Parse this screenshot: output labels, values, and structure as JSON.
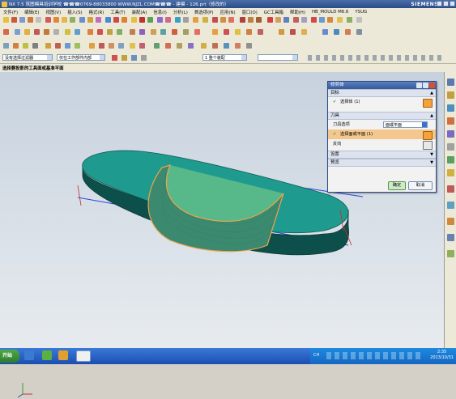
{
  "window": {
    "title": "NX 7.5 筑图模具培训学校  ☎☎☎0769-88033800  WWW.NJZL.COM☎☎☎ - 建模 - 126.prt（修改的）",
    "brand": "SIEMENS"
  },
  "menu": [
    "文件(F)",
    "编辑(E)",
    "视图(V)",
    "插入(S)",
    "格式(R)",
    "工具(T)",
    "装配(A)",
    "信息(I)",
    "分析(L)",
    "首选项(P)",
    "应用(N)",
    "窗口(O)",
    "GC工具箱",
    "帮助(H)",
    "HB_MOULD M6.6",
    "YSUG"
  ],
  "selection_bar": {
    "filter": "没有选择过滤器",
    "scope": "仅在工作部件内部",
    "snap": "1 整个装配"
  },
  "status": "选择要投影的工具面或基准平面",
  "dialog": {
    "title": "修剪体",
    "section_target": "目标",
    "target_select": "选择体 (1)",
    "section_tool": "刀具",
    "tool_option_label": "刀具选项",
    "tool_option_value": "面或平面",
    "tool_select": "选择面或平面 (1)",
    "reverse_label": "反向",
    "section_settings": "设置",
    "section_preview": "预览",
    "ok": "确定",
    "cancel": "取消"
  },
  "taskbar": {
    "start": "开始",
    "lang": "CH",
    "time": "2:35",
    "date": "2013/10/31"
  },
  "colors": {
    "part_top": "#1f9a8e",
    "part_side": "#0d4f4a",
    "trim_face": "#57b98a",
    "datum_line": "#2a45d8",
    "edge_highlight": "#f0a24a"
  }
}
